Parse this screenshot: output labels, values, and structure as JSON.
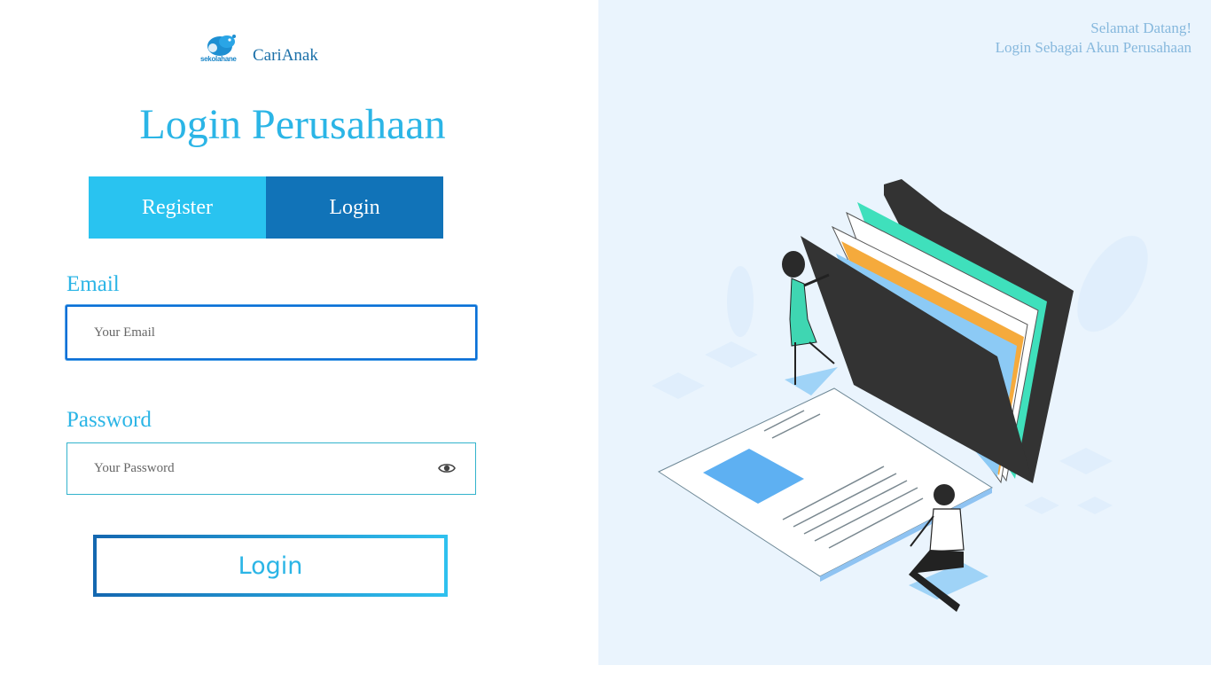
{
  "brand": {
    "logo_text": "sekolahane",
    "name": "CariAnak"
  },
  "page_title": "Login Perusahaan",
  "tabs": [
    {
      "label": "Register"
    },
    {
      "label": "Login"
    }
  ],
  "form": {
    "email_label": "Email",
    "email_placeholder": "Your Email",
    "email_value": "",
    "password_label": "Password",
    "password_placeholder": "Your Password",
    "password_value": "",
    "submit_label": "Login"
  },
  "welcome": {
    "line1": "Selamat Datang!",
    "line2": "Login Sebagai Akun Perusahaan"
  },
  "icons": {
    "password_toggle": "eye-icon",
    "brand": "hippo-logo-icon"
  },
  "colors": {
    "accent": "#2bb5e6",
    "tab_register": "#29c3f0",
    "tab_login": "#1173b8",
    "panel_bg": "#eaf4fd"
  }
}
